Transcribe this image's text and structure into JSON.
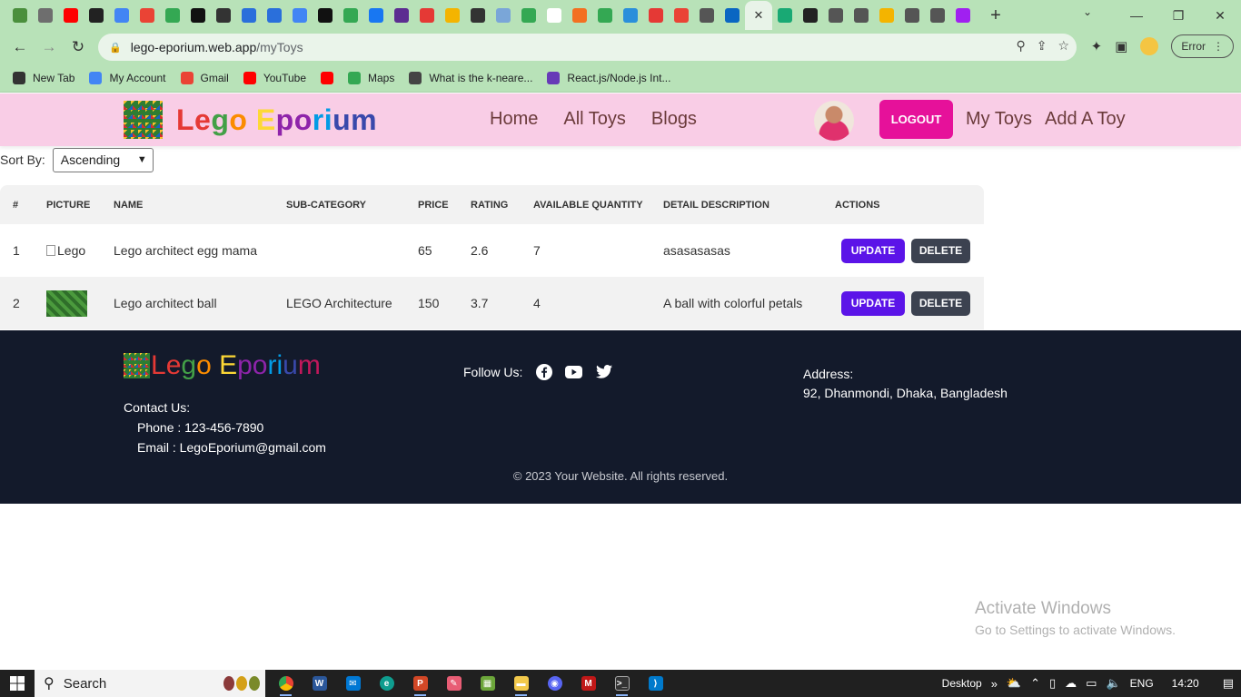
{
  "browser": {
    "url_host": "lego-eporium.web.app",
    "url_path": "/myToys",
    "error_label": "Error",
    "bookmarks": [
      {
        "label": "New Tab",
        "color": "#333333"
      },
      {
        "label": "My Account",
        "color": "#4285f4"
      },
      {
        "label": "Gmail",
        "color": "#ea4335"
      },
      {
        "label": "YouTube",
        "color": "#ff0000"
      },
      {
        "label": "",
        "color": "#ff0000"
      },
      {
        "label": "Maps",
        "color": "#34a853"
      },
      {
        "label": "What is the k-neare...",
        "color": "#444444"
      },
      {
        "label": "React.js/Node.js Int...",
        "color": "#673ab7"
      }
    ],
    "tab_colors": [
      "#4a8f3c",
      "#6e6e6e",
      "#ff0000",
      "#222222",
      "#4285f4",
      "#ea4335",
      "#34a853",
      "#111111",
      "#333333",
      "#2a6fdb",
      "#2a6fdb",
      "#4285f4",
      "#111111",
      "#34a853",
      "#1877f2",
      "#5c2d91",
      "#e53935",
      "#f4b400",
      "#333333",
      "#7aa6d8",
      "#34a853",
      "#ffffff",
      "#f37021",
      "#34a853",
      "#2a8fdb",
      "#e53935",
      "#ea4335",
      "#555555",
      "#0a66c2"
    ],
    "tab_colors_after": [
      "#19a974",
      "#222222",
      "#555555",
      "#555555",
      "#f4b400",
      "#555555",
      "#555555",
      "#a020f0"
    ]
  },
  "site": {
    "logo_letters": [
      {
        "ch": "L",
        "color": "#e53935"
      },
      {
        "ch": "e",
        "color": "#e53935"
      },
      {
        "ch": "g",
        "color": "#43a047"
      },
      {
        "ch": "o",
        "color": "#fb8c00"
      },
      {
        "ch": " ",
        "color": "#000000"
      },
      {
        "ch": "E",
        "color": "#fdd835"
      },
      {
        "ch": "p",
        "color": "#8e24aa"
      },
      {
        "ch": "o",
        "color": "#8e24aa"
      },
      {
        "ch": "r",
        "color": "#039be5"
      },
      {
        "ch": "i",
        "color": "#039be5"
      },
      {
        "ch": "u",
        "color": "#3949ab"
      },
      {
        "ch": "m",
        "color": "#3949ab"
      }
    ],
    "nav": [
      "Home",
      "All Toys",
      "Blogs"
    ],
    "logout": "LOGOUT",
    "nav_right": [
      "My Toys",
      "Add A Toy"
    ],
    "header_bg": "#f9cde6",
    "accent": "#e6119a"
  },
  "sort": {
    "label": "Sort By:",
    "selected": "Ascending"
  },
  "table": {
    "headers": [
      "#",
      "PICTURE",
      "NAME",
      "SUB-CATEGORY",
      "PRICE",
      "RATING",
      "AVAILABLE QUANTITY",
      "DETAIL DESCRIPTION",
      "ACTIONS"
    ],
    "rows": [
      {
        "num": "1",
        "picture_alt": "Lego",
        "picture_broken": true,
        "name": "Lego architect egg mama",
        "subcategory": "",
        "price": "65",
        "rating": "2.6",
        "quantity": "7",
        "description": "asasasasas"
      },
      {
        "num": "2",
        "picture_alt": "",
        "picture_broken": false,
        "name": "Lego architect ball",
        "subcategory": "LEGO Architecture",
        "price": "150",
        "rating": "3.7",
        "quantity": "4",
        "description": "A ball with colorful petals"
      }
    ],
    "update_label": "UPDATE",
    "delete_label": "DELETE"
  },
  "footer": {
    "logo_letters": [
      {
        "ch": "L",
        "color": "#e53935"
      },
      {
        "ch": "e",
        "color": "#e53935"
      },
      {
        "ch": "g",
        "color": "#43a047"
      },
      {
        "ch": "o",
        "color": "#fb8c00"
      },
      {
        "ch": " ",
        "color": "#000000"
      },
      {
        "ch": "E",
        "color": "#fdd835"
      },
      {
        "ch": "p",
        "color": "#8e24aa"
      },
      {
        "ch": "o",
        "color": "#8e24aa"
      },
      {
        "ch": "r",
        "color": "#039be5"
      },
      {
        "ch": "i",
        "color": "#039be5"
      },
      {
        "ch": "u",
        "color": "#3949ab"
      },
      {
        "ch": "m",
        "color": "#c2185b"
      }
    ],
    "contact_title": "Contact Us:",
    "phone": "Phone : 123-456-7890",
    "email": "Email : LegoEporium@gmail.com",
    "follow": "Follow Us:",
    "address_title": "Address:",
    "address": "92, Dhanmondi, Dhaka, Bangladesh",
    "copyright": "© 2023 Your Website. All rights reserved."
  },
  "watermark": {
    "line1": "Activate Windows",
    "line2": "Go to Settings to activate Windows."
  },
  "taskbar": {
    "search": "Search",
    "desktop": "Desktop",
    "lang": "ENG",
    "time": "14:20"
  }
}
